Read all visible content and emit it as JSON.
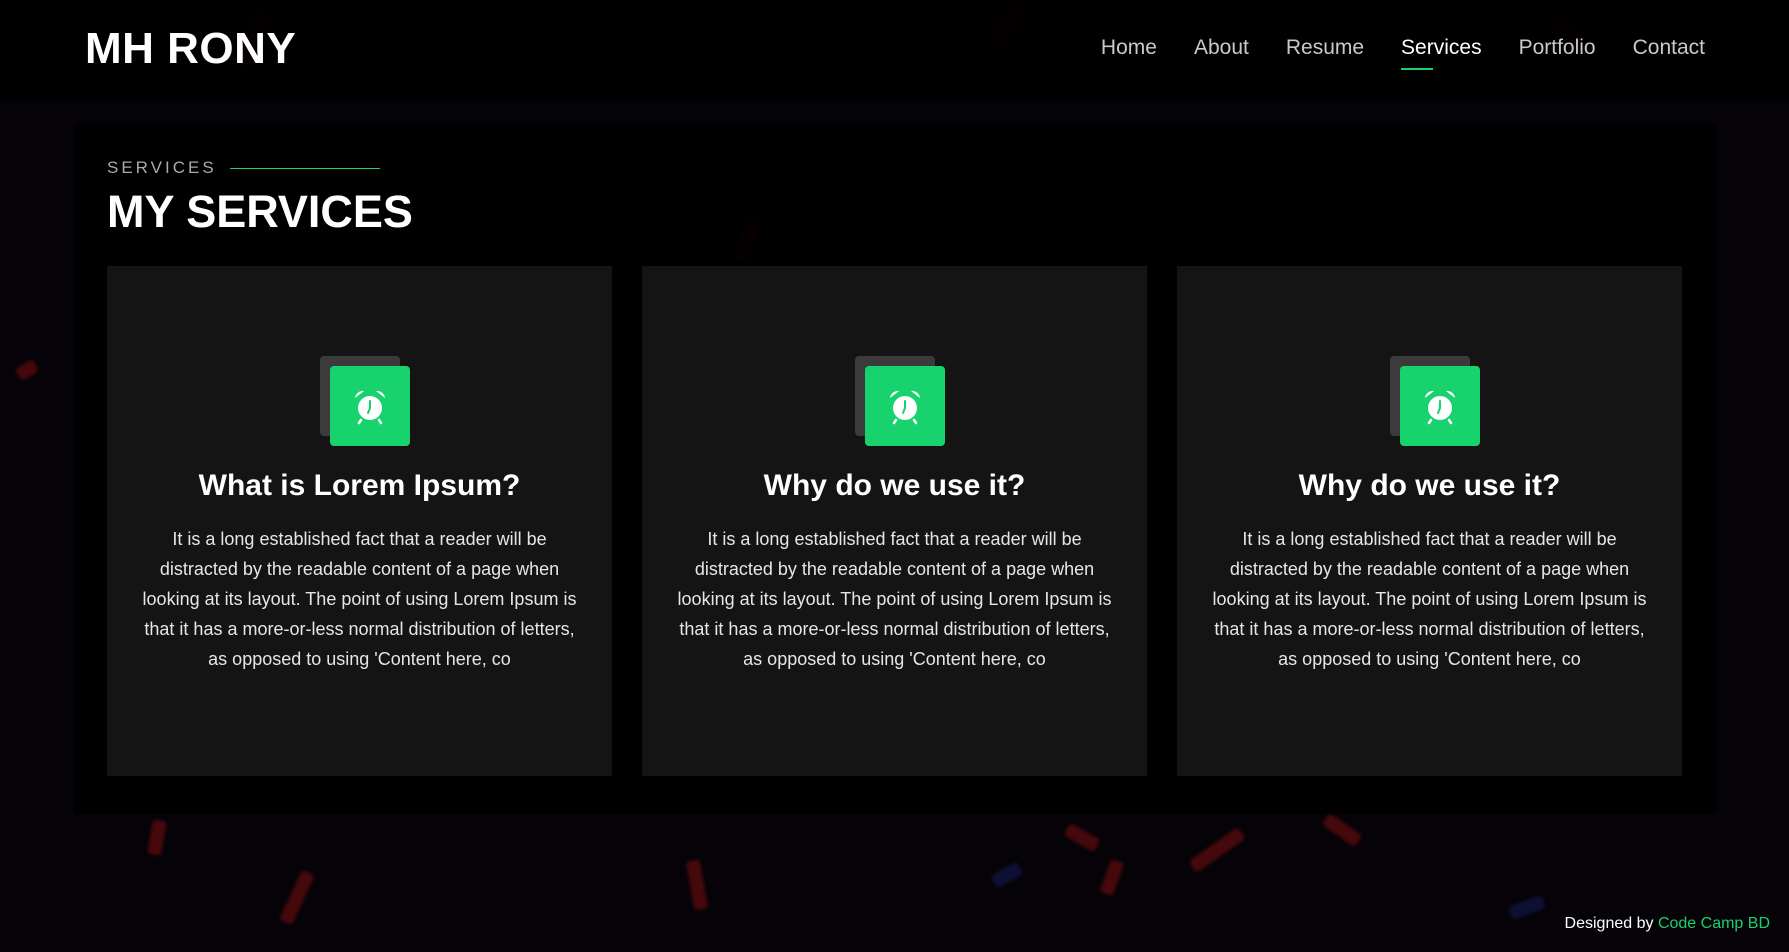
{
  "brand": {
    "name": "MH RONY"
  },
  "nav": {
    "items": [
      {
        "label": "Home"
      },
      {
        "label": "About"
      },
      {
        "label": "Resume"
      },
      {
        "label": "Services"
      },
      {
        "label": "Portfolio"
      },
      {
        "label": "Contact"
      }
    ],
    "active": "Services"
  },
  "section": {
    "label": "SERVICES",
    "title": "MY SERVICES"
  },
  "cards": [
    {
      "icon": "alarm-clock-icon",
      "title": "What is Lorem Ipsum?",
      "text": "It is a long established fact that a reader will be distracted by the readable content of a page when looking at its layout. The point of using Lorem Ipsum is that it has a more-or-less normal distribution of letters, as opposed to using 'Content here, co"
    },
    {
      "icon": "alarm-clock-icon",
      "title": "Why do we use it?",
      "text": "It is a long established fact that a reader will be distracted by the readable content of a page when looking at its layout. The point of using Lorem Ipsum is that it has a more-or-less normal distribution of letters, as opposed to using 'Content here, co"
    },
    {
      "icon": "alarm-clock-icon",
      "title": "Why do we use it?",
      "text": "It is a long established fact that a reader will be distracted by the readable content of a page when looking at its layout. The point of using Lorem Ipsum is that it has a more-or-less normal distribution of letters, as opposed to using 'Content here, co"
    }
  ],
  "footer": {
    "prefix": "Designed by",
    "link": "Code Camp BD"
  },
  "colors": {
    "accent": "#18d26e",
    "card_bg": "#141414",
    "page_bg": "#050307"
  }
}
